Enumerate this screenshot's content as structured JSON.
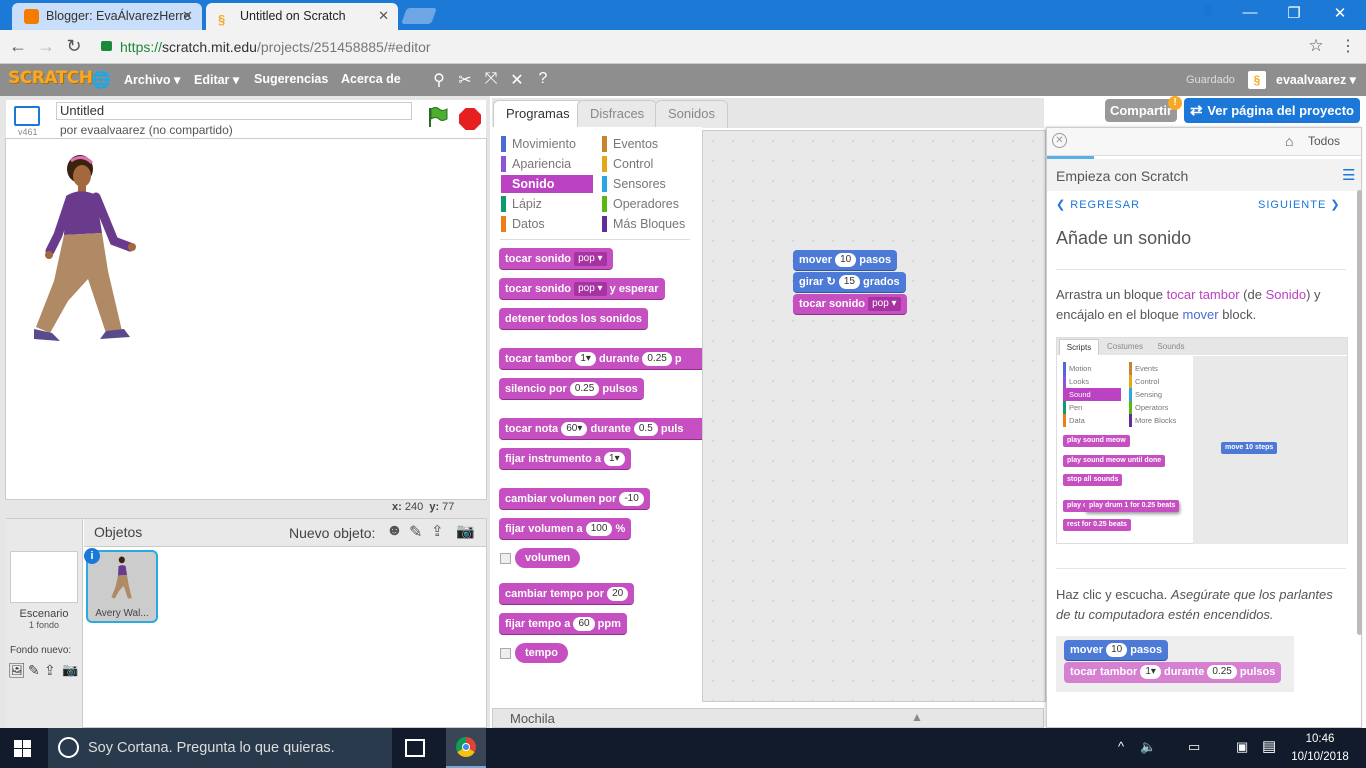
{
  "browser": {
    "tabs": [
      {
        "title": "Blogger: EvaÁlvarezHerre",
        "active": false
      },
      {
        "title": "Untitled on Scratch",
        "active": true
      }
    ],
    "url": {
      "scheme": "https://",
      "domain": "scratch.mit.edu",
      "path": "/projects/251458885/#editor"
    }
  },
  "menubar": {
    "logo": "SCRATCH",
    "items": [
      "Archivo ▾",
      "Editar ▾",
      "Sugerencias",
      "Acerca de"
    ],
    "saved_status": "Guardado",
    "username": "evaalvaarez ▾"
  },
  "project": {
    "title": "Untitled",
    "version": "v461",
    "author_line": "por evaalvaarez (no compartido)"
  },
  "stage": {
    "coords_x_label": "x:",
    "coords_x": "240",
    "coords_y_label": "y:",
    "coords_y": "77"
  },
  "sprites": {
    "header": "Objetos",
    "new_sprite_label": "Nuevo objeto:",
    "stage_label": "Escenario",
    "stage_backdrops": "1 fondo",
    "new_backdrop_label": "Fondo nuevo:",
    "sprite_name": "Avery Wal..."
  },
  "tabs": [
    "Programas",
    "Disfraces",
    "Sonidos"
  ],
  "categories_left": [
    {
      "label": "Movimiento",
      "color": "#4a6cd4"
    },
    {
      "label": "Apariencia",
      "color": "#8a55d7"
    },
    {
      "label": "Sonido",
      "color": "#bb42c3"
    },
    {
      "label": "Lápiz",
      "color": "#0e9a6c"
    },
    {
      "label": "Datos",
      "color": "#ee7d16"
    }
  ],
  "categories_right": [
    {
      "label": "Eventos",
      "color": "#c88330"
    },
    {
      "label": "Control",
      "color": "#e1a91a"
    },
    {
      "label": "Sensores",
      "color": "#2ca5e2"
    },
    {
      "label": "Operadores",
      "color": "#5cb712"
    },
    {
      "label": "Más Bloques",
      "color": "#632d99"
    }
  ],
  "palette": {
    "play_sound": "tocar sonido",
    "pop": "pop",
    "play_sound_wait": "tocar sonido",
    "wait_suffix": "y esperar",
    "stop_all": "detener todos los sonidos",
    "drum": "tocar tambor",
    "drum_val": "1",
    "during": "durante",
    "drum_beats": "0.25",
    "drum_tail": "p",
    "rest": "silencio por",
    "rest_val": "0.25",
    "beats": "pulsos",
    "note": "tocar nota",
    "note_val": "60",
    "note_during": "durante",
    "note_beats": "0.5",
    "note_tail": "puls",
    "instrument": "fijar instrumento a",
    "instrument_val": "1",
    "change_volume": "cambiar volumen por",
    "change_volume_val": "-10",
    "set_volume": "fijar volumen a",
    "set_volume_val": "100",
    "percent": "%",
    "volume": "volumen",
    "change_tempo": "cambiar tempo por",
    "change_tempo_val": "20",
    "set_tempo": "fijar tempo a",
    "set_tempo_val": "60",
    "bpm": "ppm",
    "tempo": "tempo"
  },
  "script": {
    "move": "mover",
    "move_val": "10",
    "steps": "pasos",
    "turn": "girar",
    "turn_icon": "↻",
    "turn_val": "15",
    "degrees": "grados",
    "play": "tocar sonido",
    "play_val": "pop"
  },
  "backpack": "Mochila",
  "share": {
    "share_label": "Compartir",
    "view_label": "Ver página del proyecto"
  },
  "tips": {
    "all_label": "Todos",
    "section_title": "Empieza con Scratch",
    "back": "REGRESAR",
    "next": "SIGUIENTE",
    "heading": "Añade un sonido",
    "p1_a": "Arrastra un bloque ",
    "p1_b": "tocar tambor",
    "p1_c": " (de ",
    "p1_d": "Sonido",
    "p1_e": ") y encájalo en el bloque ",
    "p1_f": "mover",
    "p1_g": " block.",
    "p2_a": "Haz clic y escucha. ",
    "p2_b": "Asegúrate que los parlantes de tu computadora estén encendidos.",
    "example": {
      "move": "mover",
      "move_val": "10",
      "steps": "pasos",
      "drum": "tocar tambor",
      "drum_val": "1",
      "during": "durante",
      "beats_val": "0.25",
      "beats": "pulsos"
    },
    "mini": {
      "tabs": [
        "Scripts",
        "Costumes",
        "Sounds"
      ],
      "cats_left": [
        "Motion",
        "Looks",
        "Sound",
        "Pen",
        "Data"
      ],
      "cats_right": [
        "Events",
        "Control",
        "Sensing",
        "Operators",
        "More Blocks"
      ],
      "blocks": [
        "play sound",
        "meow",
        "play sound",
        "meow",
        "until done",
        "stop all sounds",
        "play c",
        "play drum",
        "1",
        "for",
        "0.25",
        "beats",
        "rest for",
        "0.25",
        "beats"
      ],
      "move": "move",
      "move_val": "10",
      "steps": "steps"
    }
  },
  "taskbar": {
    "search_placeholder": "Soy Cortana. Pregunta lo que quieras.",
    "time": "10:46",
    "date": "10/10/2018"
  }
}
